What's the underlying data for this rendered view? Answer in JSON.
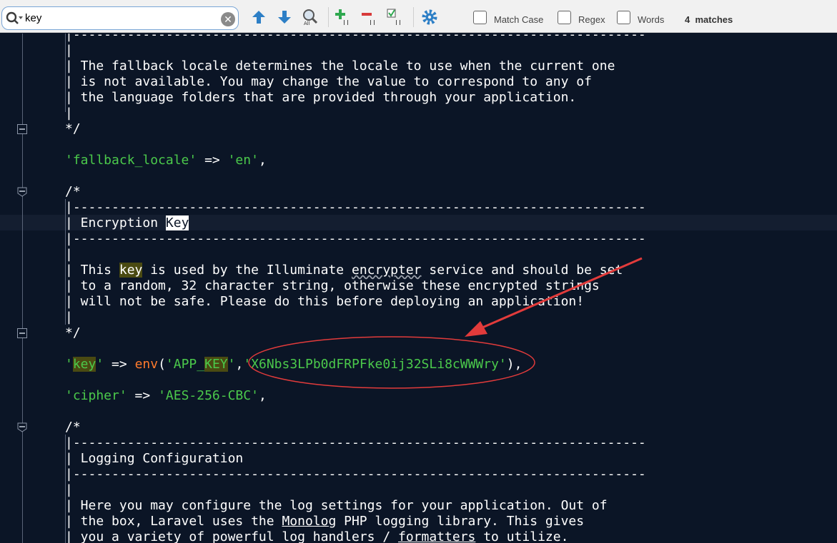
{
  "search": {
    "value": "key",
    "placeholder": "",
    "match_case_label": "Match Case",
    "regex_label": "Regex",
    "words_label": "Words",
    "matches_count": "4",
    "matches_label": "matches"
  },
  "code": {
    "line1": "|--------------------------------------------------------------------------",
    "line2": "|",
    "line3": "| The fallback locale determines the locale to use when the current one",
    "line4": "| is not available. You may change the value to correspond to any of",
    "line5": "| the language folders that are provided through your application.",
    "line6": "|",
    "line7": "*/",
    "fallback_key": "'fallback_locale'",
    "fallback_arrow": " => ",
    "fallback_val": "'en'",
    "fallback_end": ",",
    "comment_open": "/*",
    "dashes": "|--------------------------------------------------------------------------",
    "enc_prefix": "| Encryption ",
    "enc_key": "Key",
    "bar": "|",
    "this_prefix": "| This ",
    "this_key": "key",
    "this_mid": " is used by the Illuminate ",
    "this_encrypter": "encrypter",
    "this_rest": " service and should be set",
    "to_random": "| to a random, 32 character string, otherwise these encrypted strings",
    "will_not": "| will not be safe. Please do this before deploying an application!",
    "comment_close": "*/",
    "key_q1": "'",
    "key_word": "key",
    "key_q2": "'",
    "key_arrow": " => ",
    "key_env": "env",
    "key_paren": "(",
    "app_a": "'APP_",
    "app_b": "KEY",
    "app_c": "'",
    "key_comma": ",",
    "key_value": "'X6Nbs3LPb0dFRPFke0ij32SLi8cWWWry'",
    "key_end": "),",
    "cipher_key": "'cipher'",
    "cipher_arrow": " => ",
    "cipher_val": "'AES-256-CBC'",
    "cipher_end": ",",
    "log_title": "| Logging Configuration",
    "here1": "| Here you may configure the log settings for your application. Out of",
    "here2a": "| the box, Laravel uses the ",
    "here2b": "Monolog",
    "here2c": " PHP logging library. This gives",
    "here3a": "| you a variety of powerful log handlers / ",
    "here3b": "formatters",
    "here3c": " to utilize."
  },
  "colors": {
    "background": "#0b1526",
    "string": "#4bc94b",
    "function": "#ff7a2c",
    "highlight": "#4a4a12",
    "annotation": "#e23b3b"
  }
}
